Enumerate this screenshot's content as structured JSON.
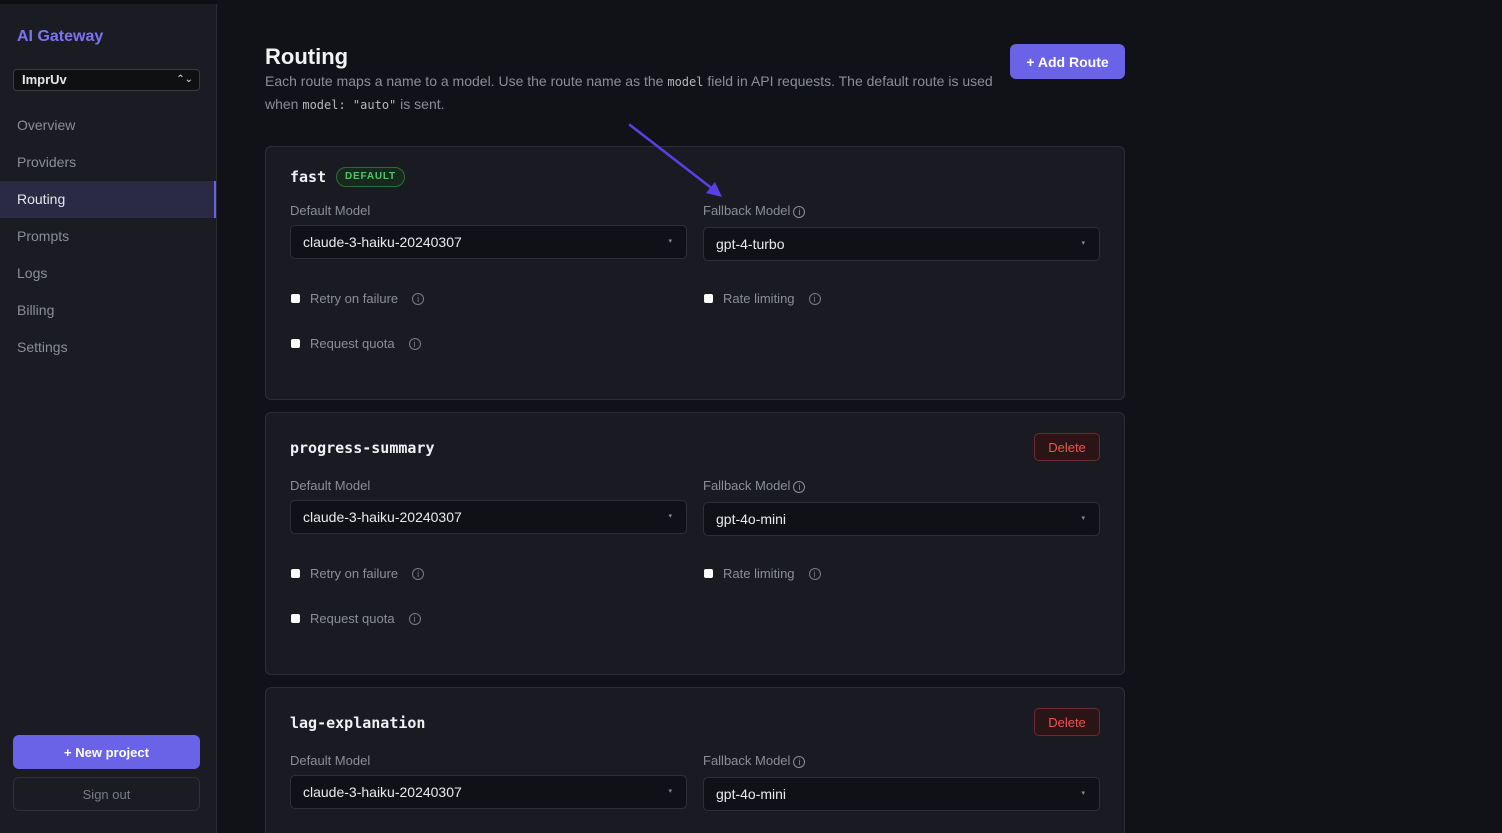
{
  "sidebar": {
    "brand": "AI Gateway",
    "project": "ImprUv",
    "nav": [
      "Overview",
      "Providers",
      "Routing",
      "Prompts",
      "Logs",
      "Billing",
      "Settings"
    ],
    "active": "Routing",
    "new_project": "+ New project",
    "sign_out": "Sign out"
  },
  "header": {
    "title": "Routing",
    "desc_1": "Each route maps a name to a model. Use the route name as the ",
    "desc_code_1": "model",
    "desc_2": " field in API requests. The default route is used when ",
    "desc_code_2": "model: \"auto\"",
    "desc_3": " is sent.",
    "add_route": "+ Add Route"
  },
  "labels": {
    "default_model": "Default Model",
    "fallback_model": "Fallback Model",
    "retry": "Retry on failure",
    "rate_limiting": "Rate limiting",
    "request_quota": "Request quota",
    "delete": "Delete",
    "info_glyph": "i",
    "caret": "▾",
    "select_caret": "⌃⌄"
  },
  "routes": [
    {
      "name": "fast",
      "badge": "DEFAULT",
      "default_model": "claude-3-haiku-20240307",
      "fallback_model": "gpt-4-turbo"
    },
    {
      "name": "progress-summary",
      "default_model": "claude-3-haiku-20240307",
      "fallback_model": "gpt-4o-mini"
    },
    {
      "name": "lag-explanation",
      "default_model": "claude-3-haiku-20240307",
      "fallback_model": "gpt-4o-mini"
    }
  ],
  "colors": {
    "accent": "#6a63e8",
    "annotation_arrow": "#5b3ee6",
    "badge_green": "#4cc76a",
    "delete_red": "#ef5350"
  }
}
